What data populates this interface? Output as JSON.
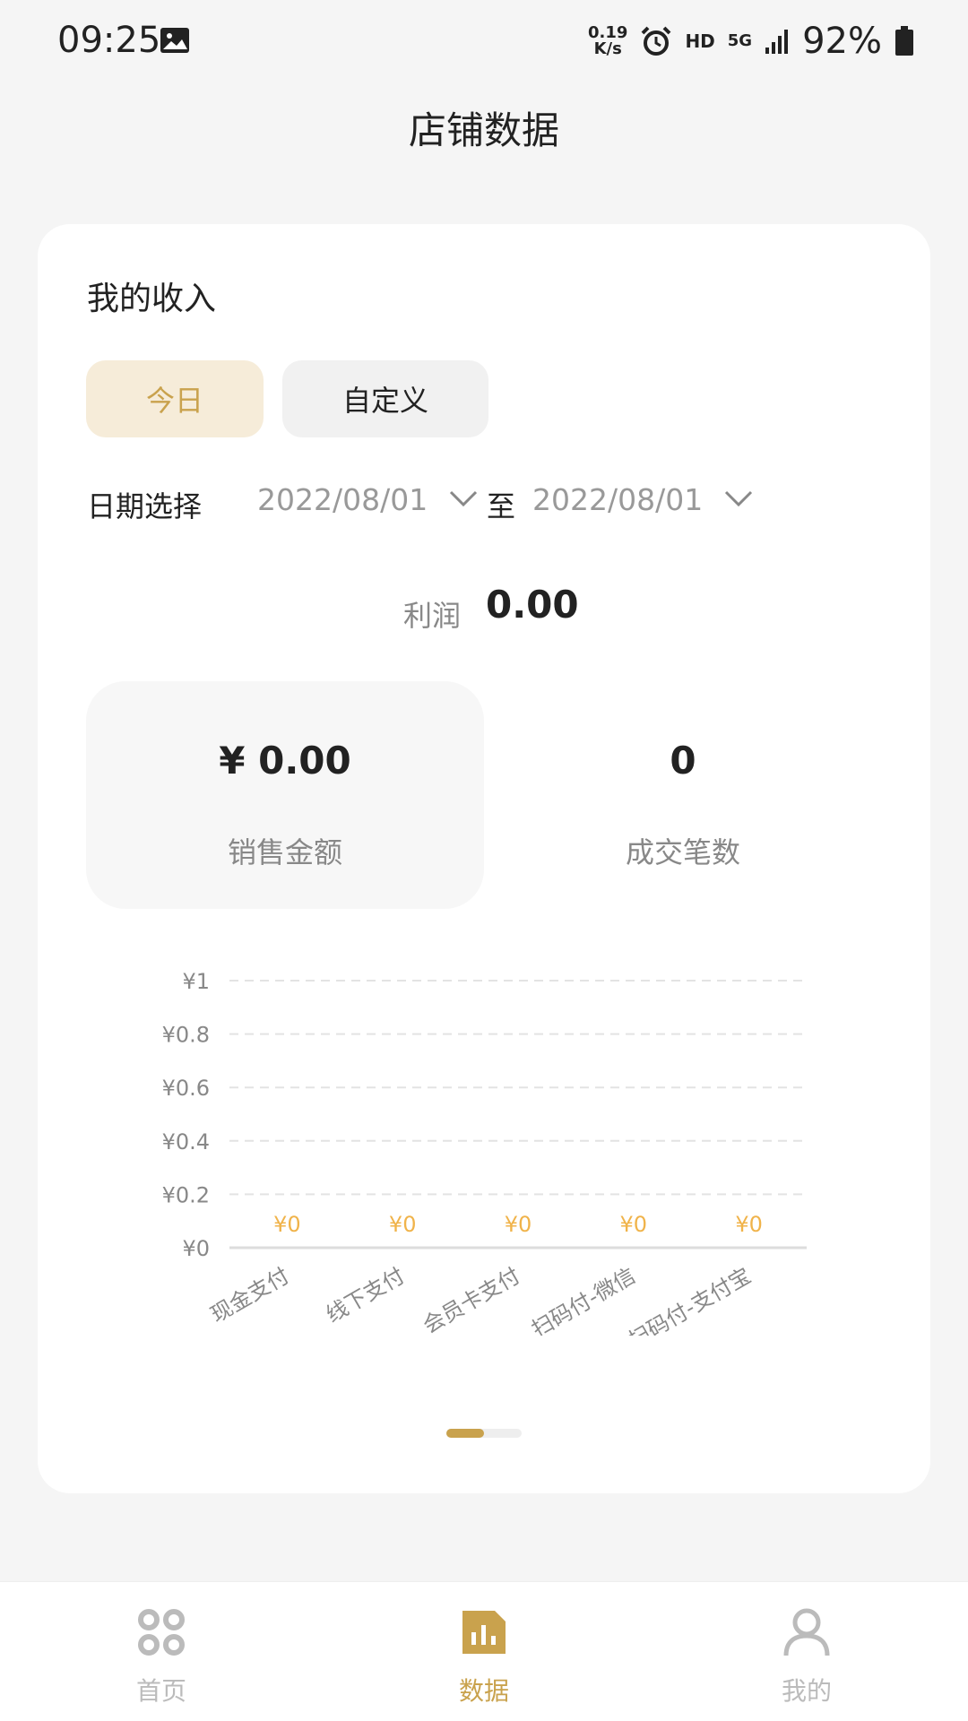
{
  "status_bar": {
    "time": "09:25",
    "net_speed_value": "0.19",
    "net_speed_unit": "K/s",
    "hd": "HD",
    "network": "5G",
    "battery": "92%"
  },
  "header": {
    "title": "店铺数据"
  },
  "income": {
    "title": "我的收入",
    "tabs": [
      {
        "label": "今日",
        "selected": true
      },
      {
        "label": "自定义",
        "selected": false
      }
    ],
    "date_label": "日期选择",
    "date_start": "2022/08/01",
    "date_separator": "至",
    "date_end": "2022/08/01",
    "profit_label": "利润",
    "profit_value": "0.00",
    "sales_amount_value": "¥ 0.00",
    "sales_amount_label": "销售金额",
    "transactions_value": "0",
    "transactions_label": "成交笔数"
  },
  "chart_data": {
    "type": "bar",
    "categories": [
      "现金支付",
      "线下支付",
      "会员卡支付",
      "扫码付-微信",
      "扫码付-支付宝"
    ],
    "values": [
      0,
      0,
      0,
      0,
      0
    ],
    "data_labels": [
      "¥0",
      "¥0",
      "¥0",
      "¥0",
      "¥0"
    ],
    "y_ticks": [
      "¥0",
      "¥0.2",
      "¥0.4",
      "¥0.6",
      "¥0.8",
      "¥1"
    ],
    "ylim": [
      0,
      1
    ],
    "grid": true,
    "colors": {
      "label": "#f0b34a",
      "grid": "#e3e3e3",
      "axis": "#dddddd",
      "tick": "#888888"
    }
  },
  "bottom_nav": {
    "items": [
      {
        "label": "首页",
        "icon": "home-grid-icon",
        "active": false
      },
      {
        "label": "数据",
        "icon": "bar-chart-icon",
        "active": true
      },
      {
        "label": "我的",
        "icon": "user-icon",
        "active": false
      }
    ]
  },
  "colors": {
    "accent": "#c9a24d",
    "accent_bg": "#f6ecd9",
    "background": "#f5f5f5"
  }
}
